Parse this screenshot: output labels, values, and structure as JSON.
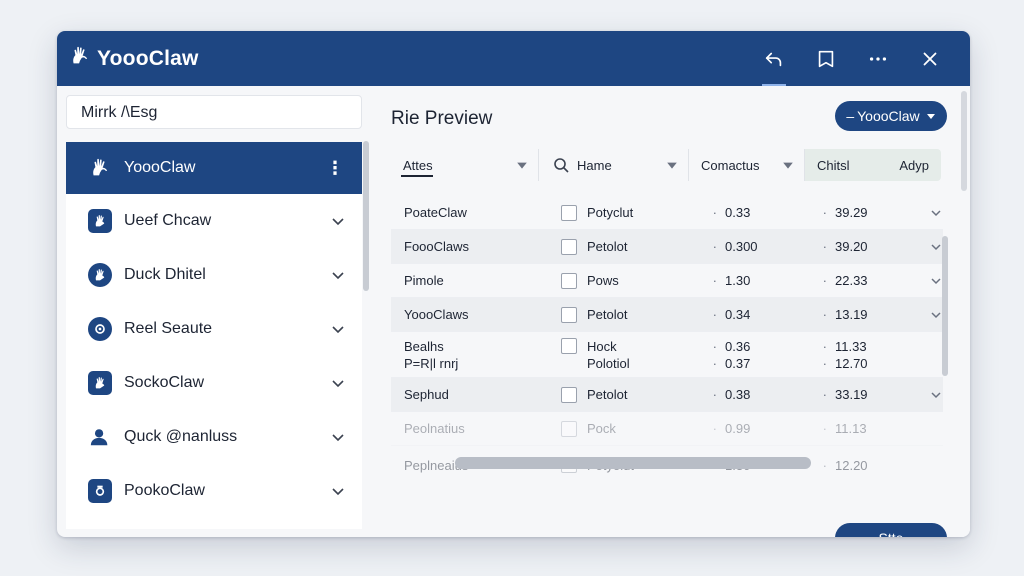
{
  "app": {
    "title": "YoooClaw"
  },
  "titlebar": {
    "actions": [
      "undo-icon",
      "bookmark-icon",
      "more-icon",
      "close-icon"
    ]
  },
  "sidebar": {
    "search_value": "Mirrk /\\Esg",
    "items": [
      {
        "label": "YoooClaw",
        "icon": "claw-icon",
        "active": true
      },
      {
        "label": "Ueef Chcaw",
        "icon": "claw-icon"
      },
      {
        "label": "Duck Dhitel",
        "icon": "claw-icon"
      },
      {
        "label": "Reel Seaute",
        "icon": "gear-icon"
      },
      {
        "label": "SockoClaw",
        "icon": "claw-icon"
      },
      {
        "label": "Quck @nanluss",
        "icon": "user-icon"
      },
      {
        "label": "PookoClaw",
        "icon": "camera-icon"
      }
    ]
  },
  "main": {
    "title": "Rie Preview",
    "dropdown_label": "YoooClaw",
    "filters": {
      "f1": "Attes",
      "f2": "Hame",
      "f3": "Comactus",
      "f4a": "Chitsl",
      "f4b": "Adyp"
    },
    "rows": [
      {
        "name": "PoateClaw",
        "type": "Potyclut",
        "a": "0.33",
        "b": "39.29"
      },
      {
        "name": "FoooClaws",
        "type": "Petolot",
        "a": "0.300",
        "b": "39.20"
      },
      {
        "name": "Pimole",
        "type": "Pows",
        "a": "1.30",
        "b": "22.33"
      },
      {
        "name": "YoooClaws",
        "type": "Petolot",
        "a": "0.34",
        "b": "13.19"
      },
      {
        "name": "Bealhs",
        "name2": "P=R|l rnrj",
        "type": "Hock",
        "type2": "Polotiol",
        "a": "0.36",
        "a2": "0.37",
        "b": "11.33",
        "b2": "12.70"
      },
      {
        "name": "Sephud",
        "type": "Petolot",
        "a": "0.38",
        "b": "33.19"
      },
      {
        "name": "Peolnatius",
        "type": "Pock",
        "a": "0.99",
        "b": "11.13"
      },
      {
        "name": "Peplneaius",
        "type": "Potyolut",
        "a": "1.30",
        "b": "12.20"
      }
    ],
    "save_label": "Stte"
  }
}
